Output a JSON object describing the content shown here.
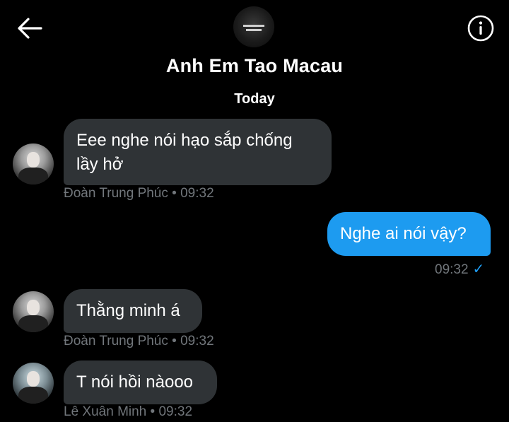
{
  "header": {
    "title": "Anh Em Tao Macau",
    "back_icon": "arrow-left-icon",
    "info_icon": "info-icon"
  },
  "date_separator": "Today",
  "messages": [
    {
      "direction": "in",
      "text": "Eee nghe nói hạo sắp chống\nlầy hở",
      "sender": "Đoàn Trung Phúc",
      "sep": "•",
      "time": "09:32"
    },
    {
      "direction": "out",
      "text": "Nghe ai nói vậy?",
      "time": "09:32",
      "status_icon": "check-icon"
    },
    {
      "direction": "in",
      "text": "Thằng minh á",
      "sender": "Đoàn Trung Phúc",
      "sep": "•",
      "time": "09:32"
    },
    {
      "direction": "in",
      "text": "T nói hồi nàooo",
      "sender": "Lê Xuân Minh",
      "sep": "•",
      "time": "09:32"
    }
  ],
  "colors": {
    "background": "#000000",
    "incoming_bubble": "#2f3336",
    "outgoing_bubble": "#1d9bf0",
    "meta_text": "#71767b"
  }
}
